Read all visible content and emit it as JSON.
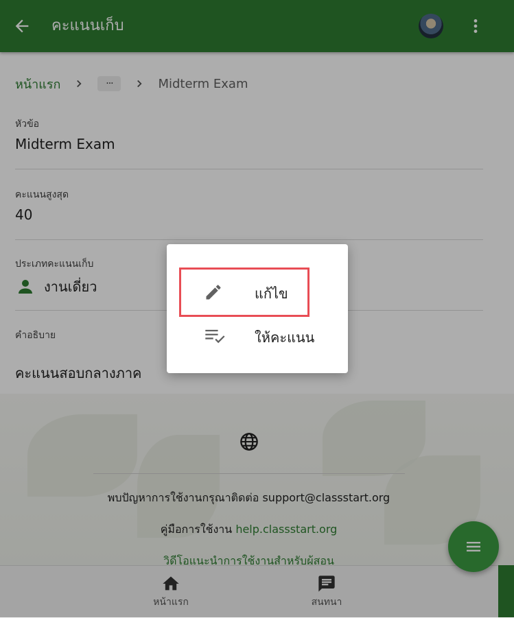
{
  "appbar": {
    "title": "คะแนนเก็บ",
    "back_icon": "arrow-back-icon",
    "more_icon": "more-vert-icon",
    "color": "#2e7d32"
  },
  "breadcrumb": {
    "home": "หน้าแรก",
    "ellipsis": "···",
    "current": "Midterm Exam"
  },
  "fields": {
    "title": {
      "label": "หัวข้อ",
      "value": "Midterm Exam"
    },
    "max_score": {
      "label": "คะแนนสูงสุด",
      "value": "40"
    },
    "type": {
      "label": "ประเภทคะแนนเก็บ",
      "value": "งานเดี่ยว",
      "icon": "person-icon"
    },
    "description": {
      "label": "คำอธิบาย",
      "value": "คะแนนสอบกลางภาค"
    }
  },
  "footer": {
    "support_text": "พบปัญหาการใช้งานกรุณาติดต่อ",
    "support_email": "support@classstart.org",
    "manual_text": "คู่มือการใช้งาน",
    "manual_link": "help.classstart.org",
    "video_link": "วิดีโอแนะนำการใช้งานสำหรับผู้สอน"
  },
  "bottom_nav": [
    {
      "label": "หน้าแรก",
      "icon": "home-icon"
    },
    {
      "label": "สนทนา",
      "icon": "chat-icon"
    }
  ],
  "fab": {
    "icon": "menu-icon",
    "color": "#3b9b42"
  },
  "menu": {
    "items": [
      {
        "label": "แก้ไข",
        "icon": "edit-icon"
      },
      {
        "label": "ให้คะแนน",
        "icon": "grading-icon"
      }
    ],
    "highlight_color": "#e84d55"
  }
}
